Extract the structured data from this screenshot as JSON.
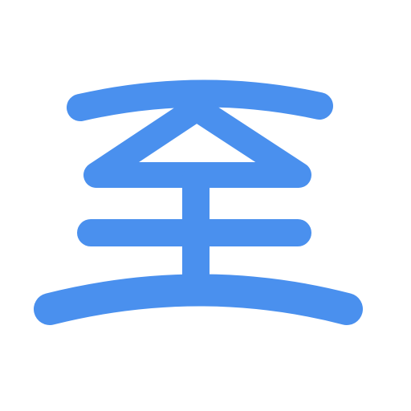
{
  "icon": {
    "name": "glyph-zhi-icon",
    "character": "至",
    "color": "#4a90ee",
    "background": "#ffffff"
  }
}
